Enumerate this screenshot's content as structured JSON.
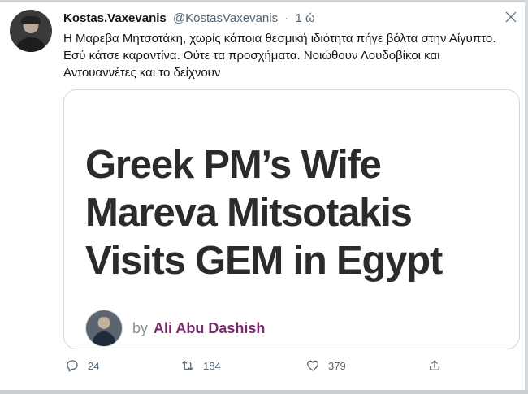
{
  "tweet": {
    "author_name": "Kostas.Vaxevanis",
    "author_handle": "@KostasVaxevanis",
    "separator": "·",
    "time": "1 ώ",
    "text": "Η Μαρεβα Μητσοτάκη, χωρίς κάποια θεσμική ιδιότητα πήγε βόλτα στην Αίγυπτο. Εσύ κάτσε καραντίνα. Ούτε τα προσχήματα. Νοιώθουν Λουδοβίκοι και Αντουαννέτες και το δείχνουν"
  },
  "card": {
    "headline": "Greek PM’s Wife Mareva Mitsotakis Visits GEM in Egypt",
    "by_label": "by",
    "author": "Ali Abu Dashish"
  },
  "actions": {
    "replies": "24",
    "retweets": "184",
    "likes": "379"
  },
  "icons": [
    "more-icon",
    "reply-icon",
    "retweet-icon",
    "like-icon",
    "share-icon"
  ],
  "colors": {
    "text": "#0f1419",
    "muted": "#536471",
    "card_border": "#cfd9de",
    "author_link": "#7a2a6a"
  }
}
